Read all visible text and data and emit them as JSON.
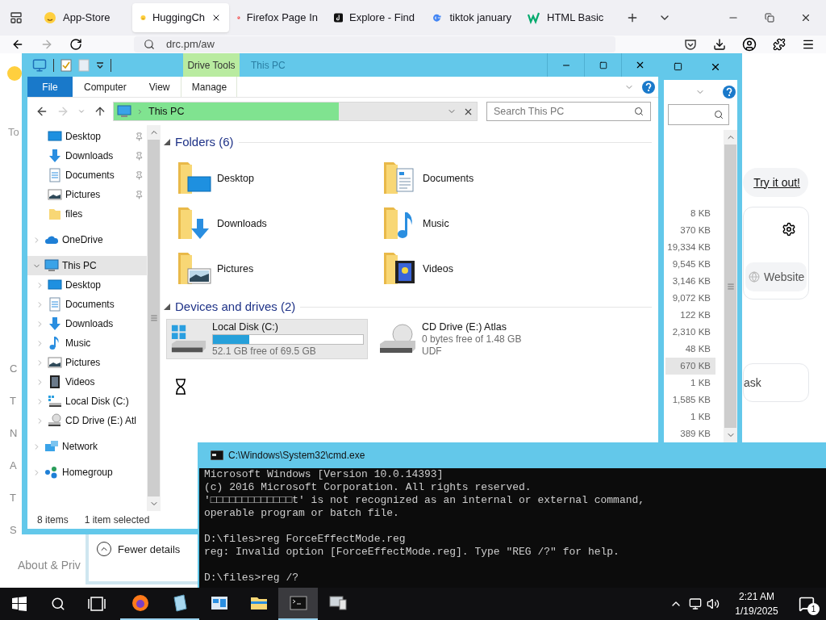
{
  "browser": {
    "tabs": [
      {
        "label": "App-Store",
        "selected": false,
        "kind": "emoji"
      },
      {
        "label": "HuggingCh",
        "selected": true,
        "kind": "emoji"
      },
      {
        "label": "Firefox Page In",
        "selected": false,
        "kind": "firefox"
      },
      {
        "label": "Explore - Find",
        "selected": false,
        "kind": "tiktok"
      },
      {
        "label": "tiktok january",
        "selected": false,
        "kind": "google"
      },
      {
        "label": "HTML Basic",
        "selected": false,
        "kind": "w3"
      }
    ],
    "address": "drc.pm/aw",
    "page": {
      "left_text": "To",
      "edge_letters": [
        "C",
        "T",
        "N",
        "A",
        "T",
        "S"
      ],
      "footer_link": "About & Priv",
      "try_link": "Try it out!",
      "website_button": "Website",
      "card_text": "ask"
    }
  },
  "back_explorer": {
    "sizes": [
      {
        "text": "8 KB",
        "selected": false
      },
      {
        "text": "370 KB",
        "selected": false
      },
      {
        "text": "19,334 KB",
        "selected": false
      },
      {
        "text": "9,545 KB",
        "selected": false
      },
      {
        "text": "3,146 KB",
        "selected": false
      },
      {
        "text": "9,072 KB",
        "selected": false
      },
      {
        "text": "122 KB",
        "selected": false
      },
      {
        "text": "2,310 KB",
        "selected": false
      },
      {
        "text": "48 KB",
        "selected": false
      },
      {
        "text": "670 KB",
        "selected": true
      },
      {
        "text": "1 KB",
        "selected": false
      },
      {
        "text": "1,585 KB",
        "selected": false
      },
      {
        "text": "1 KB",
        "selected": false
      },
      {
        "text": "389 KB",
        "selected": false
      }
    ]
  },
  "copy_dialog": {
    "toggle": "Fewer details"
  },
  "explorer": {
    "title": "This PC",
    "context_tab": "Drive Tools",
    "ribbon_tabs": [
      {
        "label": "File",
        "kind": "file"
      },
      {
        "label": "Computer",
        "kind": "tab"
      },
      {
        "label": "View",
        "kind": "tab"
      },
      {
        "label": "Manage",
        "kind": "context"
      }
    ],
    "address": {
      "path": "This PC",
      "level": 0.62
    },
    "search": {
      "placeholder": "Search This PC"
    },
    "quick_access": [
      {
        "label": "Desktop",
        "kind": "desktop",
        "pinned": true,
        "selected": false
      },
      {
        "label": "Downloads",
        "kind": "downloads",
        "pinned": true,
        "selected": false
      },
      {
        "label": "Documents",
        "kind": "documents",
        "pinned": true,
        "selected": false
      },
      {
        "label": "Pictures",
        "kind": "pictures",
        "pinned": true,
        "selected": false
      },
      {
        "label": "files",
        "kind": "folder",
        "pinned": false,
        "selected": false
      }
    ],
    "tree": [
      {
        "label": "OneDrive",
        "kind": "cloud",
        "expanded": false,
        "selected": false
      },
      {
        "label": "This PC",
        "kind": "pc",
        "expanded": true,
        "selected": true,
        "children": [
          {
            "label": "Desktop",
            "kind": "desktop",
            "expanded": false,
            "selected": false
          },
          {
            "label": "Documents",
            "kind": "documents",
            "expanded": false,
            "selected": false
          },
          {
            "label": "Downloads",
            "kind": "downloads",
            "expanded": false,
            "selected": false
          },
          {
            "label": "Music",
            "kind": "music",
            "expanded": false,
            "selected": false
          },
          {
            "label": "Pictures",
            "kind": "pictures",
            "expanded": false,
            "selected": false
          },
          {
            "label": "Videos",
            "kind": "videos",
            "expanded": false,
            "selected": false
          },
          {
            "label": "Local Disk (C:)",
            "kind": "disk",
            "expanded": false,
            "selected": false
          },
          {
            "label": "CD Drive (E:) Atl",
            "kind": "cd",
            "expanded": false,
            "selected": false
          }
        ]
      },
      {
        "label": "Network",
        "kind": "network",
        "expanded": false,
        "selected": false
      },
      {
        "label": "Homegroup",
        "kind": "homegroup",
        "expanded": false,
        "selected": false
      }
    ],
    "folders": {
      "title": "Folders (6)",
      "items": [
        {
          "label": "Desktop",
          "kind": "desktop"
        },
        {
          "label": "Documents",
          "kind": "documents"
        },
        {
          "label": "Downloads",
          "kind": "downloads"
        },
        {
          "label": "Music",
          "kind": "music"
        },
        {
          "label": "Pictures",
          "kind": "pictures"
        },
        {
          "label": "Videos",
          "kind": "videos"
        }
      ]
    },
    "drives": {
      "title": "Devices and drives (2)",
      "items": [
        {
          "label": "Local Disk (C:)",
          "kind": "disk",
          "selected": true,
          "level": 0.24,
          "detail": "52.1 GB free of 69.5 GB"
        },
        {
          "label": "CD Drive (E:) Atlas",
          "kind": "cd",
          "selected": false,
          "detail": "0 bytes free of 1.48 GB",
          "filesystem": "UDF"
        }
      ]
    },
    "status": {
      "count": "8 items",
      "selection": "1 item selected"
    }
  },
  "cmd": {
    "title": "C:\\Windows\\System32\\cmd.exe",
    "blocks": [
      [
        "Microsoft Windows [Version 10.0.14393]",
        "(c) 2016 Microsoft Corporation. All rights reserved.",
        "'□□□□□□□□□□□□□t' is not recognized as an internal or external command,",
        "operable program or batch file."
      ],
      [
        "D:\\files>reg ForceEffectMode.reg",
        "reg: Invalid option [ForceEffectMode.reg]. Type \"REG /?\" for help."
      ],
      [
        "D:\\files>reg /?"
      ]
    ]
  },
  "taskbar": {
    "apps": [
      {
        "kind": "firefox",
        "running": true,
        "active": false
      },
      {
        "kind": "notepad",
        "running": true,
        "active": false
      },
      {
        "kind": "control",
        "running": false,
        "active": false
      },
      {
        "kind": "explorer",
        "running": false,
        "active": false
      },
      {
        "kind": "cmd",
        "running": true,
        "active": true
      },
      {
        "kind": "system",
        "running": false,
        "active": false
      }
    ],
    "time": "2:21 AM",
    "date": "1/19/2025",
    "notifications": "1"
  }
}
